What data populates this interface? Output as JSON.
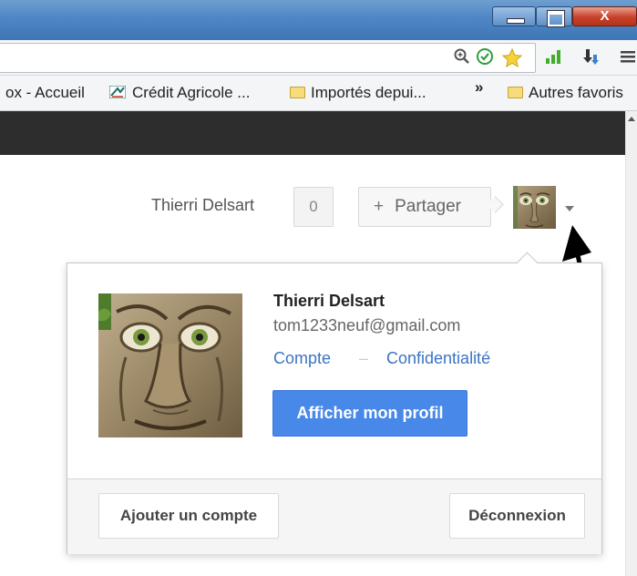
{
  "window": {
    "close_glyph": "X"
  },
  "omnibox": {
    "icons": [
      "zoom-icon",
      "check-icon",
      "star-icon",
      "signal-icon",
      "download-icon",
      "menu-icon"
    ]
  },
  "bookmarks": {
    "items": [
      {
        "label": "ox - Accueil"
      },
      {
        "label": "Crédit Agricole ..."
      },
      {
        "label": "Importés depui..."
      }
    ],
    "overflow_label": "»",
    "other_label": "Autres favoris"
  },
  "header": {
    "username": "Thierri Delsart",
    "notification_count": "0",
    "share_icon": "+",
    "share_label": "Partager"
  },
  "popup": {
    "name": "Thierri Delsart",
    "email": "tom1233neuf@gmail.com",
    "account_link": "Compte",
    "separator": "–",
    "privacy_link": "Confidentialité",
    "profile_button": "Afficher mon profil",
    "add_account_button": "Ajouter un compte",
    "logout_button": "Déconnexion"
  },
  "colors": {
    "accent_blue": "#4788e8",
    "link_blue": "#3b74c4",
    "dark_bar": "#2d2d2d"
  }
}
